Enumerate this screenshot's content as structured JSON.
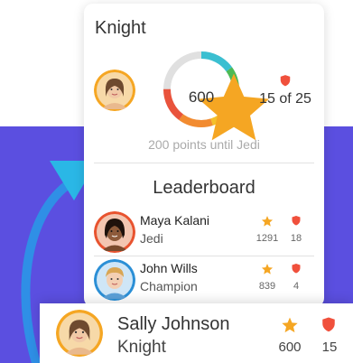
{
  "profile": {
    "rank": "Knight",
    "points": "600",
    "points_value": 600,
    "badges_text": "15 of 25",
    "until_next": "200 points until Jedi",
    "progress_fraction": 0.75
  },
  "leaderboard": {
    "title": "Leaderboard",
    "entries": [
      {
        "name": "Maya Kalani",
        "rank": "Jedi",
        "points": "1291",
        "badges": "18"
      },
      {
        "name": "John Wills",
        "rank": "Champion",
        "points": "839",
        "badges": "4"
      }
    ]
  },
  "current_user": {
    "name": "Sally Johnson",
    "rank": "Knight",
    "points": "600",
    "badges": "15"
  },
  "colors": {
    "background_purple": "#5b4fe0",
    "star": "#f5a623",
    "shield": "#f0503c",
    "ring_track": "#e0e0e0",
    "ring_teal": "#3bbfd1",
    "ring_green": "#4cba55",
    "ring_yellow": "#f5c02a",
    "ring_orange": "#f28b30",
    "ring_red": "#e9533c",
    "accent_arrow": "#2ab7e6"
  },
  "icons": {
    "star": "star-icon",
    "shield": "shield-icon",
    "arrow": "arrow-icon"
  }
}
